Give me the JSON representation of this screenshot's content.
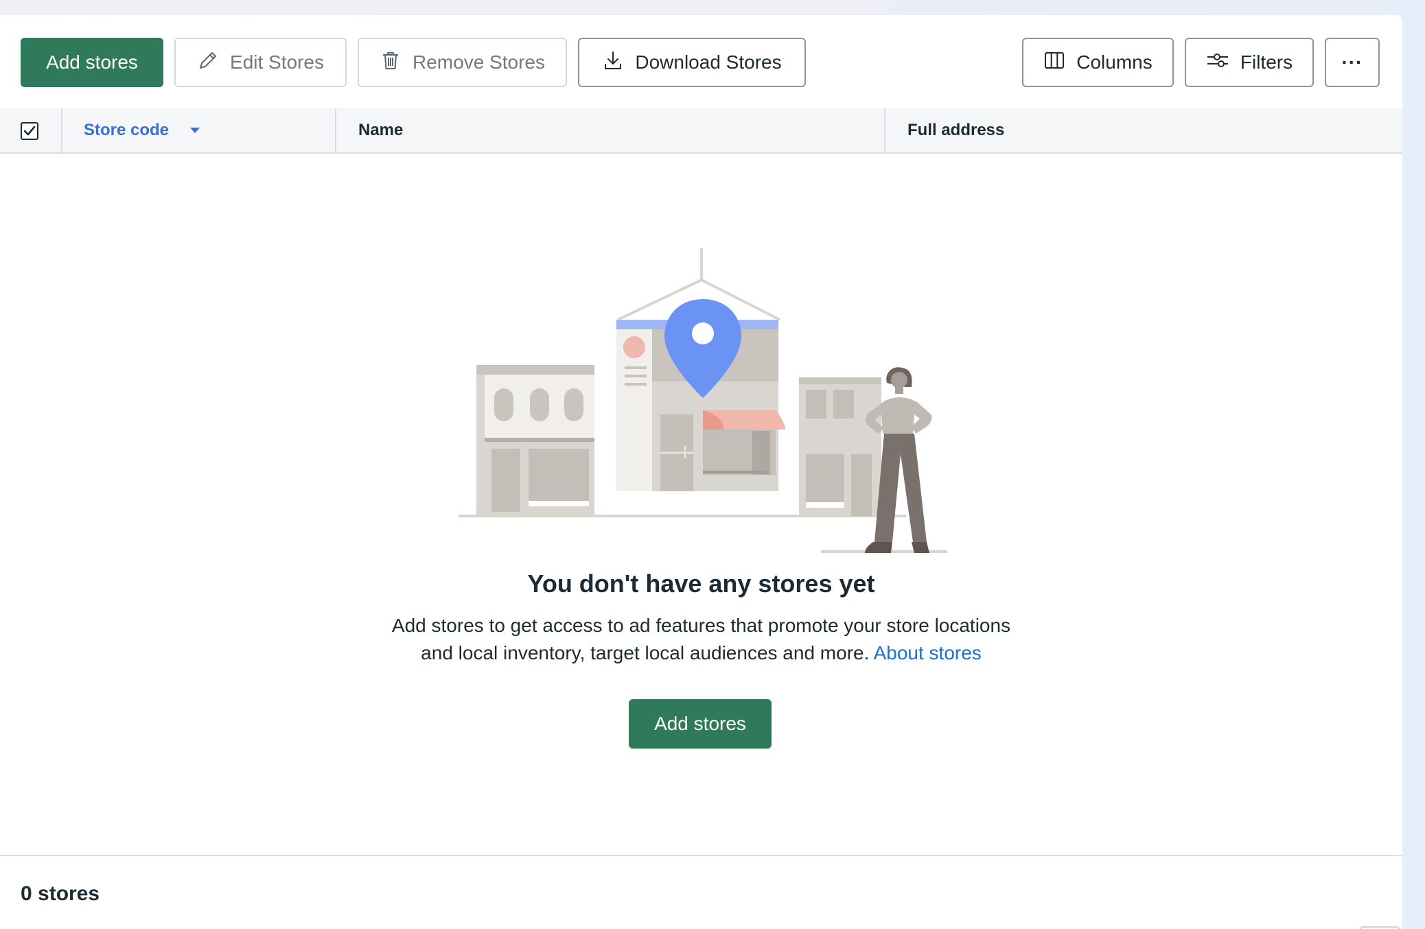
{
  "toolbar": {
    "add_label": "Add stores",
    "edit_label": "Edit Stores",
    "remove_label": "Remove Stores",
    "download_label": "Download Stores",
    "columns_label": "Columns",
    "filters_label": "Filters",
    "more_label": "···"
  },
  "table": {
    "select_all_checked": true,
    "columns": [
      "Store code",
      "Name",
      "Full address"
    ],
    "sorted_column": "Store code",
    "sort_direction": "descending"
  },
  "empty_state": {
    "title": "You don't have any stores yet",
    "description_line1": "Add stores to get access to ad features that promote your store locations",
    "description_line2": "and local inventory, target local audiences and more.",
    "link_label": "About stores",
    "cta_label": "Add stores"
  },
  "footer": {
    "count_label": "0 stores"
  },
  "colors": {
    "primary": "#2f7a5a",
    "link": "#1a6ed8",
    "sort_header": "#3b6fd4",
    "pin": "#6b93f4"
  }
}
